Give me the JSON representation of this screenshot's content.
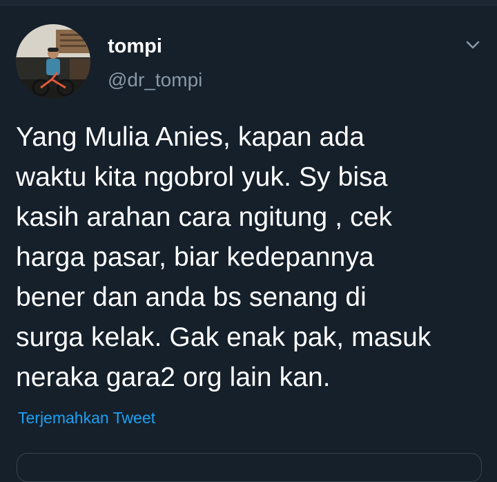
{
  "user": {
    "display_name": "tompi",
    "handle": "@dr_tompi"
  },
  "tweet": {
    "lines": [
      "Yang Mulia Anies, kapan ada",
      "waktu kita ngobrol yuk. Sy bisa",
      "kasih arahan cara ngitung , cek",
      "harga pasar, biar kedepannya",
      "bener dan anda bs senang di",
      "surga kelak. Gak enak pak, masuk",
      "neraka gara2 org lain kan."
    ],
    "translate_label": "Terjemahkan Tweet"
  },
  "icons": {
    "more_menu": "chevron-down-icon",
    "avatar": "profile-photo"
  },
  "colors": {
    "background": "#15202b",
    "text": "#ffffff",
    "muted": "#8899a6",
    "link": "#1da1f2"
  }
}
